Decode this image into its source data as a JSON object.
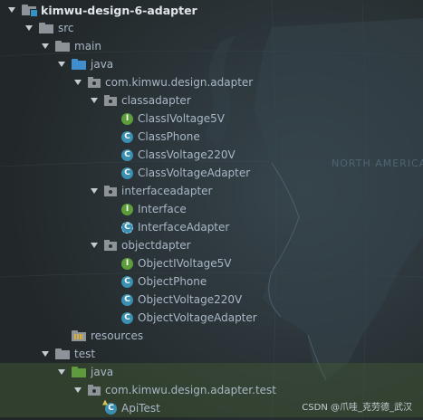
{
  "project_tree": {
    "root": "kimwu-design-6-adapter",
    "src": "src",
    "main": "main",
    "java_main": "java",
    "package_main": "com.kimwu.design.adapter",
    "classadapter": "classadapter",
    "class_items": [
      "ClassIVoltage5V",
      "ClassPhone",
      "ClassVoltage220V",
      "ClassVoltageAdapter"
    ],
    "interfaceadapter": "interfaceadapter",
    "interface_items": [
      "Interface",
      "InterfaceAdapter"
    ],
    "objectdapter": "objectdapter",
    "object_items": [
      "ObjectIVoltage5V",
      "ObjectPhone",
      "ObjectVoltage220V",
      "ObjectVoltageAdapter"
    ],
    "resources": "resources",
    "test": "test",
    "java_test": "java",
    "package_test": "com.kimwu.design.adapter.test",
    "api_test": "ApiTest"
  },
  "background": {
    "map_label": "NORTH AMERICA"
  },
  "watermark": "CSDN @爪哇_克劳德_武汉",
  "colors": {
    "background": "#252c30",
    "text": "#a9b7c6",
    "folder_blue": "#3f8fd0",
    "folder_green": "#5f9a3c",
    "class_icon": "#3b8fb0",
    "interface_icon": "#5d9e3b",
    "test_highlight": "#3c4e33"
  },
  "icons": {
    "module": "module-folder-icon",
    "folder": "folder-icon",
    "source_folder": "source-folder-icon",
    "test_folder": "test-source-folder-icon",
    "package": "package-icon",
    "class": "class-icon",
    "interface": "interface-icon",
    "abstract_class": "abstract-class-icon",
    "test_class": "test-class-icon",
    "resources": "resources-folder-icon"
  }
}
